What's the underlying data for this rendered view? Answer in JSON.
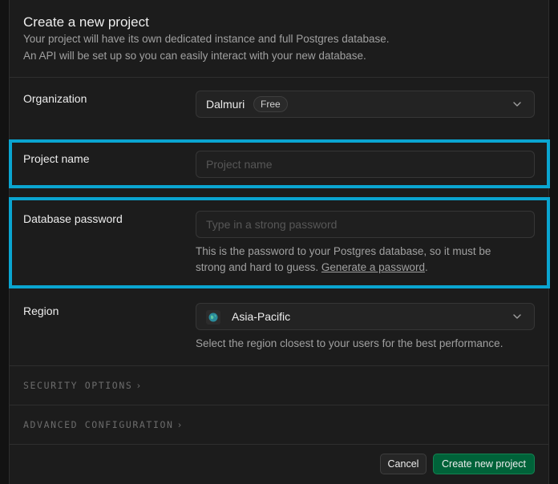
{
  "header": {
    "title": "Create a new project",
    "description_line1": "Your project will have its own dedicated instance and full Postgres database.",
    "description_line2": "An API will be set up so you can easily interact with your new database."
  },
  "organization": {
    "label": "Organization",
    "value": "Dalmuri",
    "plan_badge": "Free",
    "icon": "chevron-down-icon"
  },
  "project_name": {
    "label": "Project name",
    "placeholder": "Project name",
    "value": ""
  },
  "database_password": {
    "label": "Database password",
    "placeholder": "Type in a strong password",
    "value": "",
    "help_line1": "This is the password to your Postgres database, so it must be",
    "help_line2_prefix": "strong and hard to guess.",
    "generate_link": "Generate a password",
    "help_line2_suffix": "."
  },
  "region": {
    "label": "Region",
    "value": "Asia-Pacific",
    "icon": "globe-icon",
    "help": "Select the region closest to your users for the best performance."
  },
  "sections": {
    "security": "SECURITY OPTIONS",
    "advanced": "ADVANCED CONFIGURATION",
    "arrow": "›"
  },
  "footer": {
    "cancel_label": "Cancel",
    "create_label": "Create new project"
  },
  "colors": {
    "background": "#1c1c1c",
    "highlight": "#0aa5d1",
    "primary_button": "#006239"
  }
}
